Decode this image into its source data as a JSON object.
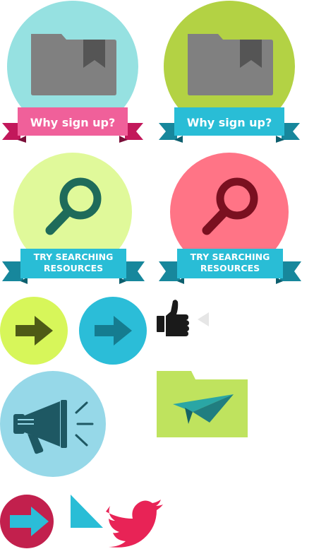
{
  "sprites": {
    "why_sign_up_teal": {
      "label": "Why sign up?",
      "icon": "folder-bookmark-icon",
      "circle_color": "#96E1E1",
      "ribbon_color": "#F0609A"
    },
    "why_sign_up_green": {
      "label": "Why sign up?",
      "icon": "folder-bookmark-icon",
      "circle_color": "#B3D244",
      "ribbon_color": "#29BDD6"
    },
    "try_searching_yellow": {
      "label_line1": "TRY SEARCHING",
      "label_line2": "RESOURCES",
      "icon": "magnifier-icon",
      "circle_color": "#E0F99A",
      "ribbon_color": "#29BDD6"
    },
    "try_searching_pink": {
      "label_line1": "TRY SEARCHING",
      "label_line2": "RESOURCES",
      "icon": "magnifier-icon",
      "circle_color": "#FF7486",
      "ribbon_color": "#29BDD6"
    },
    "arrow_green": {
      "icon": "arrow-right-icon",
      "circle_color": "#D7F65A"
    },
    "arrow_blue": {
      "icon": "arrow-right-icon",
      "circle_color": "#2BBDD8"
    },
    "thumbs_up": {
      "icon": "thumbs-up-icon"
    },
    "megaphone": {
      "icon": "megaphone-icon",
      "circle_color": "#96D8E8"
    },
    "paper_plane_folder": {
      "icon": "paper-plane-folder-icon",
      "folder_color": "#BFE35E"
    },
    "arrow_crimson": {
      "icon": "arrow-right-icon",
      "circle_color": "#C2204D"
    },
    "triangle": {
      "icon": "triangle-icon"
    },
    "twitter": {
      "icon": "twitter-bird-icon",
      "bird_color": "#E82356"
    }
  }
}
